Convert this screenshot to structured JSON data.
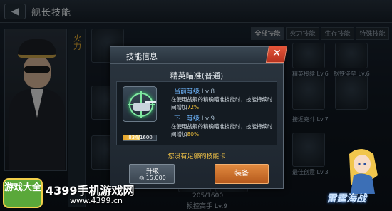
{
  "background": {
    "top_title": "舰长技能",
    "side_label": "火力",
    "tabs": [
      {
        "label": "全部技能",
        "active": true
      },
      {
        "label": "火力技能",
        "active": false
      },
      {
        "label": "生存技能",
        "active": false
      },
      {
        "label": "特殊技能",
        "active": false
      }
    ],
    "cell_labels": [
      "精英接续 Lv.6",
      "钢铁堡垒 Lv.6",
      "接近充斗 Lv.7",
      "最佳创意 Lv.3"
    ],
    "bottom_values": [
      "205/1600",
      "损控高手 Lv.9"
    ]
  },
  "dialog": {
    "title": "技能信息",
    "skill_name": "精英瞄准",
    "skill_quality": "(普通)",
    "progress_text": "834/1600",
    "progress_fraction": 0.52,
    "current": {
      "label": "当前等级",
      "level": "Lv.8",
      "desc_prefix": "在使用战舰的精确瞄准技能时，技能持续时间增加",
      "desc_value": "72%"
    },
    "next": {
      "label": "下一等级",
      "level": "Lv.9",
      "desc_prefix": "在使用战舰的精确瞄准技能时，技能持续时间增加",
      "desc_value": "80%"
    },
    "warning": "您没有足够的技能卡",
    "upgrade_label": "升级",
    "upgrade_cost": "15,000",
    "equip_label": "装备",
    "close_glyph": "✕"
  },
  "watermark": {
    "logo_text": "游戏大全",
    "site_title": "4399手机游戏网",
    "site_url": "www.4399.cn",
    "game_logo": "雷霆海战"
  }
}
